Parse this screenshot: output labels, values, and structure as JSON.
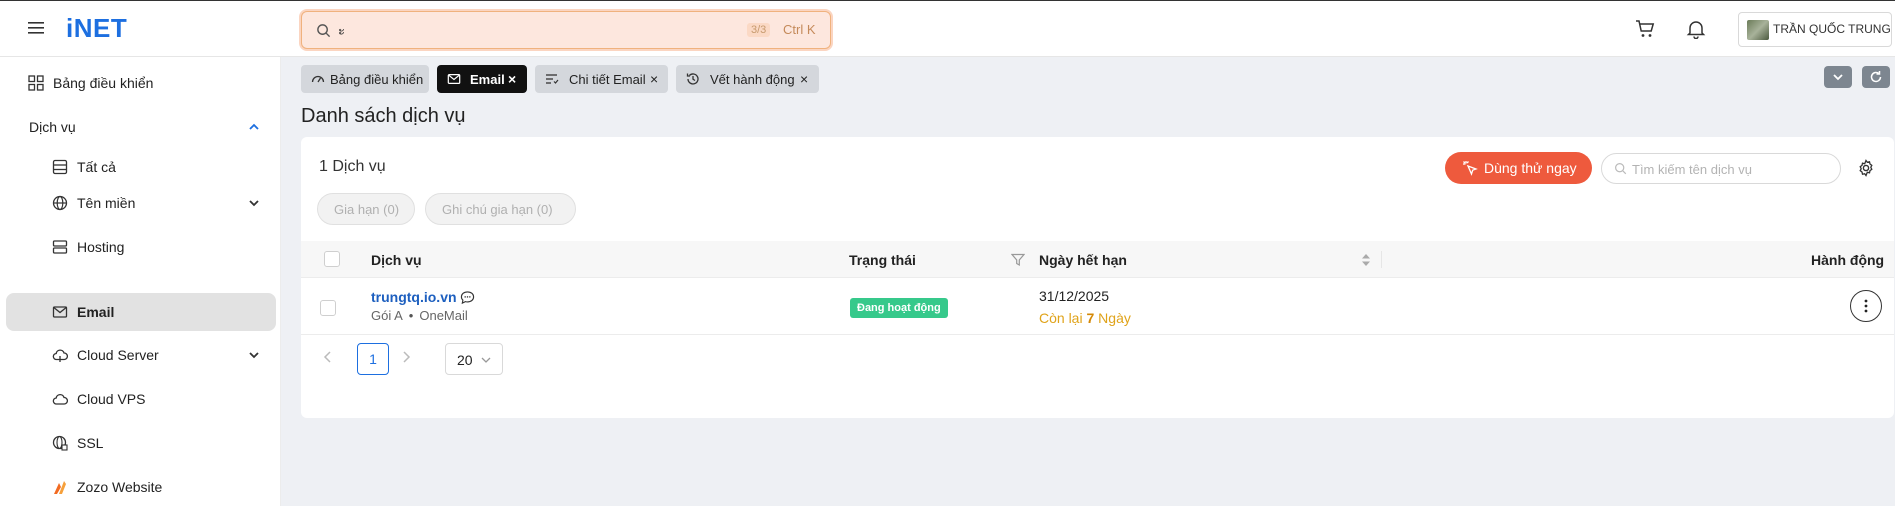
{
  "header": {
    "logo": "iNET",
    "search": {
      "value": "ะ",
      "match_count": "3/3",
      "shortcut": "Ctrl K"
    },
    "user_name": "TRẦN QUỐC TRUNG"
  },
  "sidebar": {
    "items": [
      {
        "label": "Bảng điều khiển",
        "icon": "dashboard-icon"
      },
      {
        "label": "Dịch vụ",
        "icon": "",
        "expanded": true
      },
      {
        "label": "Tất cả",
        "icon": "table-icon"
      },
      {
        "label": "Tên miền",
        "icon": "globe-icon",
        "has_children": true
      },
      {
        "label": "Hosting",
        "icon": "server-icon"
      },
      {
        "label": "Email",
        "icon": "mail-icon",
        "active": true
      },
      {
        "label": "Cloud Server",
        "icon": "cloud-icon",
        "has_children": true
      },
      {
        "label": "Cloud VPS",
        "icon": "cloud-vps-icon"
      },
      {
        "label": "SSL",
        "icon": "ssl-globe-icon"
      },
      {
        "label": "Zozo Website",
        "icon": "zozo-icon"
      }
    ]
  },
  "tabs": [
    {
      "label": "Bảng điều khiển",
      "active": false,
      "closable": false
    },
    {
      "label": "Email",
      "active": true,
      "closable": true
    },
    {
      "label": "Chi tiết Email",
      "active": false,
      "closable": true
    },
    {
      "label": "Vết hành động",
      "active": false,
      "closable": true
    }
  ],
  "page": {
    "title": "Danh sách dịch vụ",
    "service_count": "1 Dịch vụ",
    "try_button": "Dùng thử ngay",
    "search_placeholder": "Tìm kiếm tên dịch vụ",
    "filters": [
      "Gia hạn (0)",
      "Ghi chú gia hạn (0)"
    ]
  },
  "table": {
    "columns": [
      "Dịch vụ",
      "Trạng thái",
      "Ngày hết hạn",
      "Hành động"
    ],
    "rows": [
      {
        "name": "trungtq.io.vn",
        "plan": "Gói A",
        "provider": "OneMail",
        "status": "Đang hoạt động",
        "expiry": "31/12/2025",
        "remaining_prefix": "Còn lại",
        "remaining_days": "7",
        "remaining_suffix": "Ngày"
      }
    ]
  },
  "pagination": {
    "current_page": "1",
    "page_size": "20"
  },
  "colors": {
    "brand": "#1d6fe0",
    "accent": "#ee5a3d",
    "status_active": "#36c98b",
    "warning": "#e0a31a"
  }
}
